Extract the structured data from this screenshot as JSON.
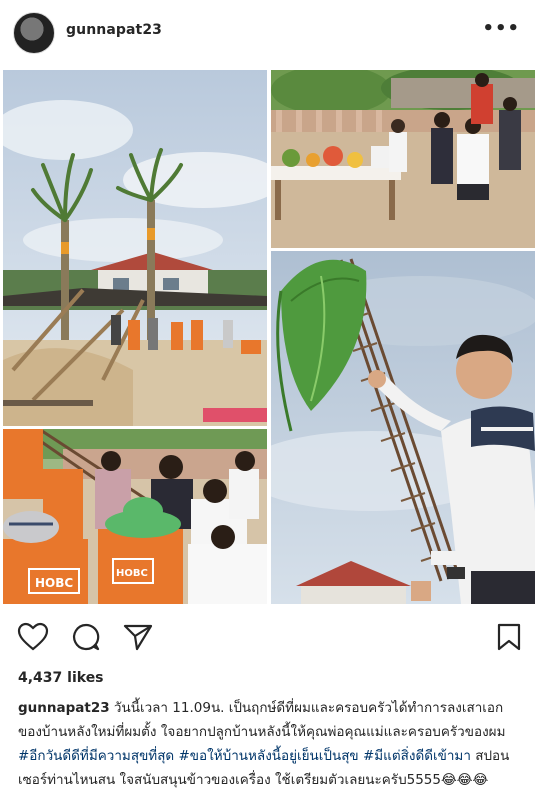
{
  "header": {
    "username": "gunnapat23",
    "more_icon": "more-horizontal-icon"
  },
  "actions": {
    "like_icon": "heart-icon",
    "comment_icon": "comment-icon",
    "share_icon": "share-icon",
    "save_icon": "bookmark-icon"
  },
  "likes": "4,437 likes",
  "caption": {
    "username": "gunnapat23",
    "text1": " วันนี้เวลา 11.09น. เป็นฤกษ์ดีที่ผมและครอบครัวได้ทำการลงเสาเอกของบ้านหลังใหม่ที่ผมตั้ง ใจอยากปลูกบ้านหลังนี้ให้คุณพ่อคุณแม่และครอบครัวของผม ",
    "tag1": "#อีกวันดีดีที่มีความสุขที่สุด",
    "sep1": " ",
    "tag2": "#ขอให้บ้านหลังนี้อยู่เย็นเป็นสุข",
    "sep2": " ",
    "tag3": "#มีแต่สิ่งดีดีเข้ามา",
    "text2": " สปอนเซอร์ท่านไหนสน ใจสนับสนุนข้าวของเครื่อง ใช้เตรียมตัวเลยนะครับ5555",
    "emoji": "😂😂😂"
  },
  "photos": {
    "shirt_text_1": "HOBC",
    "shirt_text_2": "HOBC"
  },
  "colors": {
    "hashtag": "#003569",
    "sky": "#cfdcea",
    "sand": "#d9c3a0",
    "orange": "#e8772c"
  }
}
